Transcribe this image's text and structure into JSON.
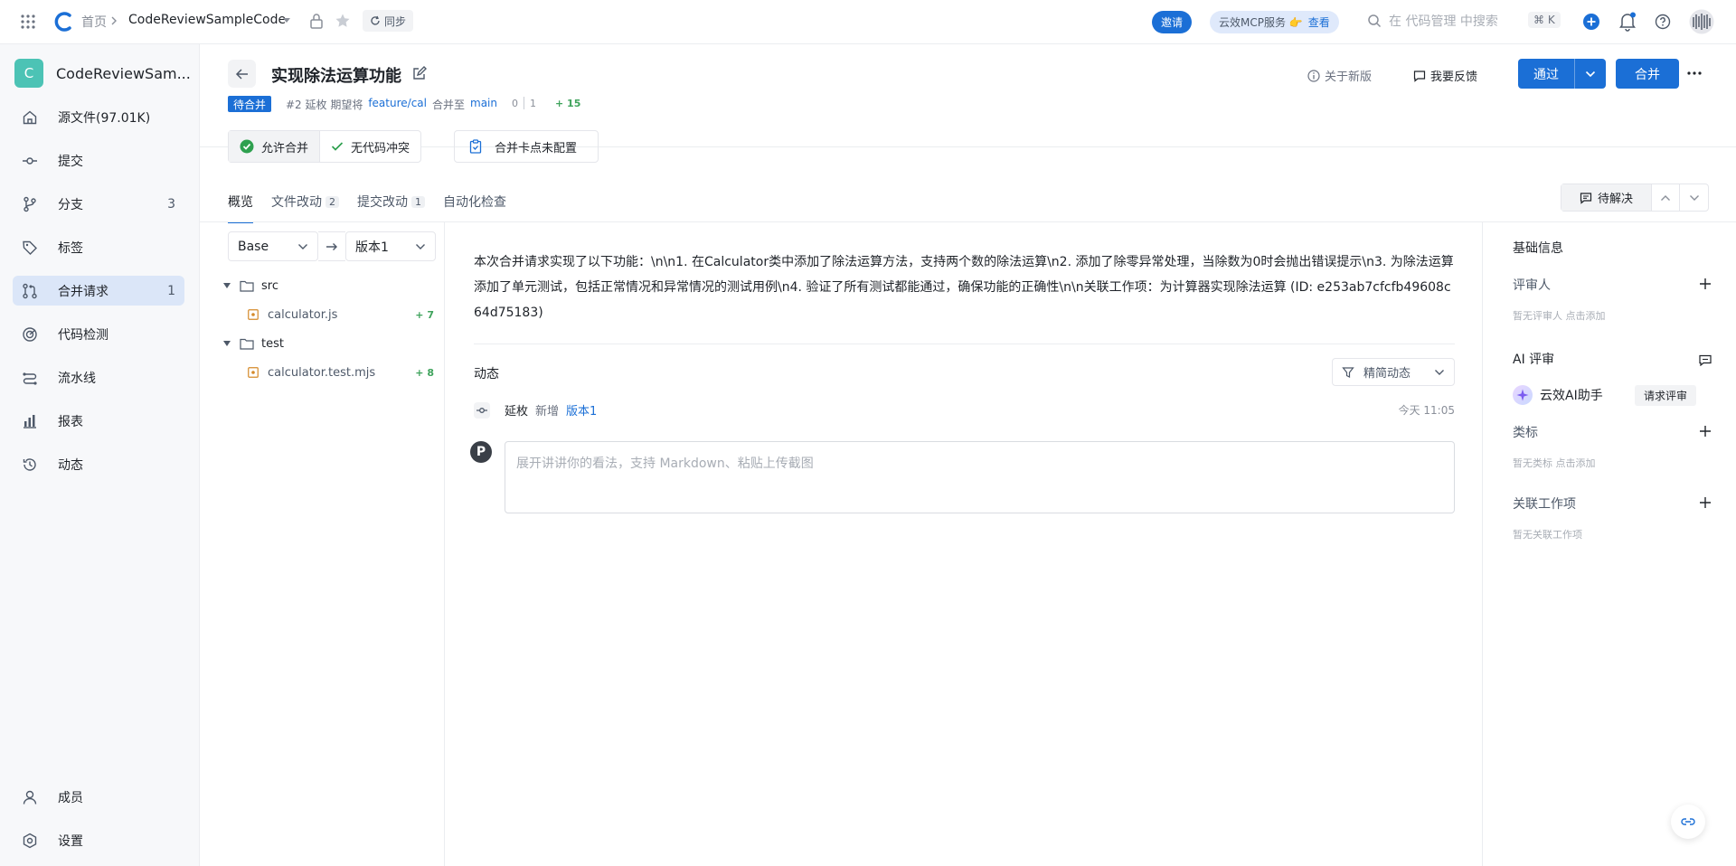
{
  "topbar": {
    "home_label": "首页",
    "repo_label": "CodeReviewSampleCode",
    "sync_label": "同步",
    "invite_label": "邀请",
    "mcp_text": "云效MCP服务 👉",
    "mcp_link": "查看",
    "search_placeholder": "在 代码管理 中搜索",
    "shortcut": "⌘ K"
  },
  "sidebar": {
    "repo_initial": "C",
    "repo_name": "CodeReviewSam...",
    "items": [
      {
        "label": "源文件(97.01K)",
        "count": "",
        "icon": "home-icon"
      },
      {
        "label": "提交",
        "count": "",
        "icon": "commit-icon"
      },
      {
        "label": "分支",
        "count": "3",
        "icon": "branch-icon"
      },
      {
        "label": "标签",
        "count": "",
        "icon": "tag-icon"
      },
      {
        "label": "合并请求",
        "count": "1",
        "icon": "merge-request-icon"
      },
      {
        "label": "代码检测",
        "count": "",
        "icon": "scan-icon"
      },
      {
        "label": "流水线",
        "count": "",
        "icon": "pipeline-icon"
      },
      {
        "label": "报表",
        "count": "",
        "icon": "report-icon"
      },
      {
        "label": "动态",
        "count": "",
        "icon": "history-icon"
      }
    ],
    "bottom": [
      {
        "label": "成员",
        "icon": "user-icon"
      },
      {
        "label": "设置",
        "icon": "settings-icon"
      }
    ]
  },
  "header": {
    "title": "实现除法运算功能",
    "status": "待合并",
    "meta_prefix": "#2 延枚 期望将",
    "source_branch": "feature/cal",
    "meta_mid": "合并至",
    "target_branch": "main",
    "diff_a": "0",
    "diff_b": "1",
    "additions": "+ 15",
    "about_new": "关于新版",
    "feedback": "我要反馈",
    "approve_label": "通过",
    "merge_label": "合并"
  },
  "checks": {
    "allow_merge": "允许合并",
    "no_conflict": "无代码冲突",
    "gate": "合并卡点未配置"
  },
  "tabs": [
    {
      "label": "概览",
      "count": ""
    },
    {
      "label": "文件改动",
      "count": "2"
    },
    {
      "label": "提交改动",
      "count": "1"
    },
    {
      "label": "自动化检查",
      "count": ""
    }
  ],
  "pending_label": "待解决",
  "tree": {
    "base": "Base",
    "version": "版本1",
    "rows": [
      {
        "type": "folder",
        "name": "src",
        "add": ""
      },
      {
        "type": "file",
        "name": "calculator.js",
        "add": "+ 7"
      },
      {
        "type": "folder",
        "name": "test",
        "add": ""
      },
      {
        "type": "file",
        "name": "calculator.test.mjs",
        "add": "+ 8"
      }
    ]
  },
  "description": "本次合并请求实现了以下功能：\\n\\n1. 在Calculator类中添加了除法运算方法，支持两个数的除法运算\\n2. 添加了除零异常处理，当除数为0时会抛出错误提示\\n3. 为除法运算添加了单元测试，包括正常情况和异常情况的测试用例\\n4. 验证了所有测试都能通过，确保功能的正确性\\n\\n关联工作项：为计算器实现除法运算 (ID: e253ab7cfcfb49608c64d75183)",
  "activity": {
    "title": "动态",
    "filter": "精简动态",
    "user": "延枚",
    "action": "新增",
    "version_link": "版本1",
    "time": "今天 11:05",
    "avatar_text": "P",
    "comment_placeholder": "展开讲讲你的看法，支持 Markdown、粘贴上传截图"
  },
  "right": {
    "basic_info": "基础信息",
    "reviewers": "评审人",
    "reviewers_hint": "暂无评审人 点击添加",
    "ai_review": "AI 评审",
    "ai_assistant": "云效AI助手",
    "request_review": "请求评审",
    "labels": "类标",
    "labels_hint": "暂无类标 点击添加",
    "work_items": "关联工作项",
    "work_items_hint": "暂无关联工作项"
  }
}
